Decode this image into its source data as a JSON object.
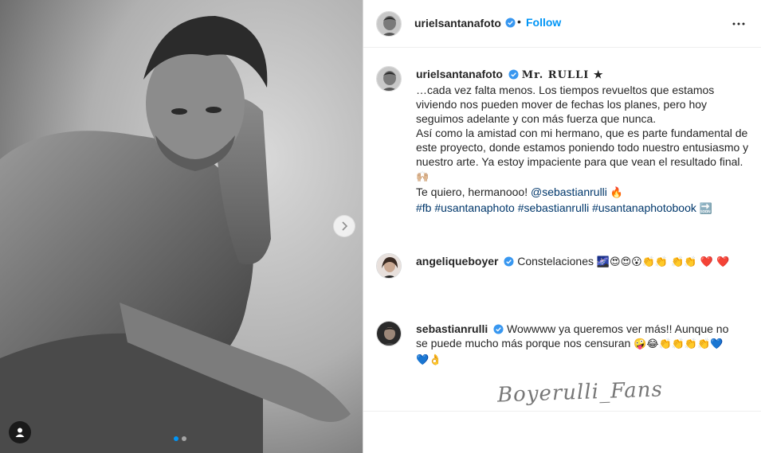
{
  "post": {
    "author": "urielsantanafoto",
    "follow_label": "Follow",
    "separator": "•"
  },
  "caption": {
    "author": "urielsantanafoto",
    "title_fancy": "Mr. RULLI ★",
    "text_1": "…cada vez falta menos. Los tiempos revueltos que estamos viviendo nos pueden mover de fechas los planes, pero hoy seguimos adelante y con más fuerza que nunca.",
    "text_2": "Así como la amistad con mi hermano, que es parte fundamental de este proyecto, donde estamos poniendo todo nuestro entusiasmo y nuestro arte. Ya estoy impaciente para que vean el resultado final.",
    "text_2_emoji": "🙌🏼",
    "text_3": "Te quiero, hermanooo!",
    "mention": "@sebastianrulli",
    "text_3_emoji": "🔥",
    "hashtags": [
      "#fb",
      "#usantanaphoto",
      "#sebastianrulli",
      "#usantanaphotobook"
    ],
    "hashtags_emoji": "🔜"
  },
  "comments": [
    {
      "author": "angeliqueboyer",
      "text": "Constelaciones",
      "emoji": "🌌😍😍😮👏👏 👏👏 ❤️ ❤️"
    },
    {
      "author": "sebastianrulli",
      "text": "Wowwww ya queremos ver más!! Aunque no se puede mucho más porque nos censuran",
      "emoji": "🤪😂👏👏👏👏💙 💙👌"
    }
  ],
  "watermark": "Boyerulli_Fans",
  "carousel": {
    "total": 2,
    "active": 1
  },
  "colors": {
    "accent": "#0095f6",
    "link": "#00376b",
    "verified": "#3897f0"
  }
}
